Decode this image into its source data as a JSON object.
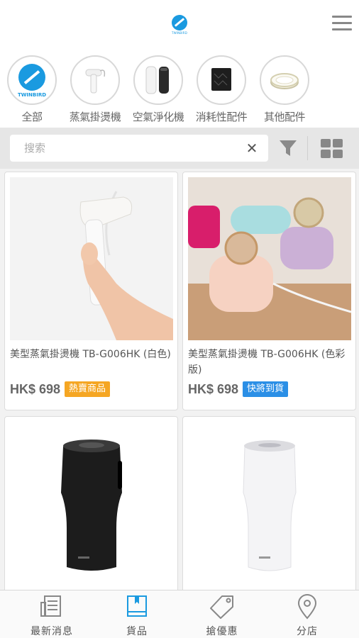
{
  "header": {
    "logo_text": "TWINBIRD",
    "logo_color": "#1a9ae0",
    "menu_icon": "hamburger-menu-icon"
  },
  "categories": [
    {
      "label": "全部",
      "brand": "TWINBIRD",
      "icon": "twinbird-logo-icon"
    },
    {
      "label": "蒸氣掛燙機",
      "icon": "garment-steamer-icon"
    },
    {
      "label": "空氣淨化機",
      "icon": "air-purifier-icon"
    },
    {
      "label": "消耗性配件",
      "icon": "filter-cartridge-icon"
    },
    {
      "label": "其他配件",
      "icon": "ring-accessory-icon"
    }
  ],
  "search": {
    "placeholder": "搜索",
    "value": "",
    "clear_icon": "close-icon",
    "filter_icon": "filter-icon",
    "view_icon": "grid-view-icon"
  },
  "products": [
    {
      "title": "美型蒸氣掛燙機 TB-G006HK (白色)",
      "price": "HK$ 698",
      "badge": "熱賣商品",
      "badge_color": "#f5a623"
    },
    {
      "title": "美型蒸氣掛燙機 TB-G006HK (色彩版)",
      "price": "HK$ 698",
      "badge": "快將到貨",
      "badge_color": "#2b8fe6"
    },
    {
      "title": "",
      "price": "",
      "badge": ""
    },
    {
      "title": "",
      "price": "",
      "badge": ""
    }
  ],
  "bottom_nav": [
    {
      "label": "最新消息",
      "icon": "newspaper-icon"
    },
    {
      "label": "貨品",
      "icon": "book-icon",
      "active": true
    },
    {
      "label": "搶優惠",
      "icon": "tag-icon"
    },
    {
      "label": "分店",
      "icon": "location-pin-icon"
    }
  ],
  "colors": {
    "accent": "#1a9ae0",
    "badge_hot": "#f5a623",
    "badge_soon": "#2b8fe6"
  }
}
